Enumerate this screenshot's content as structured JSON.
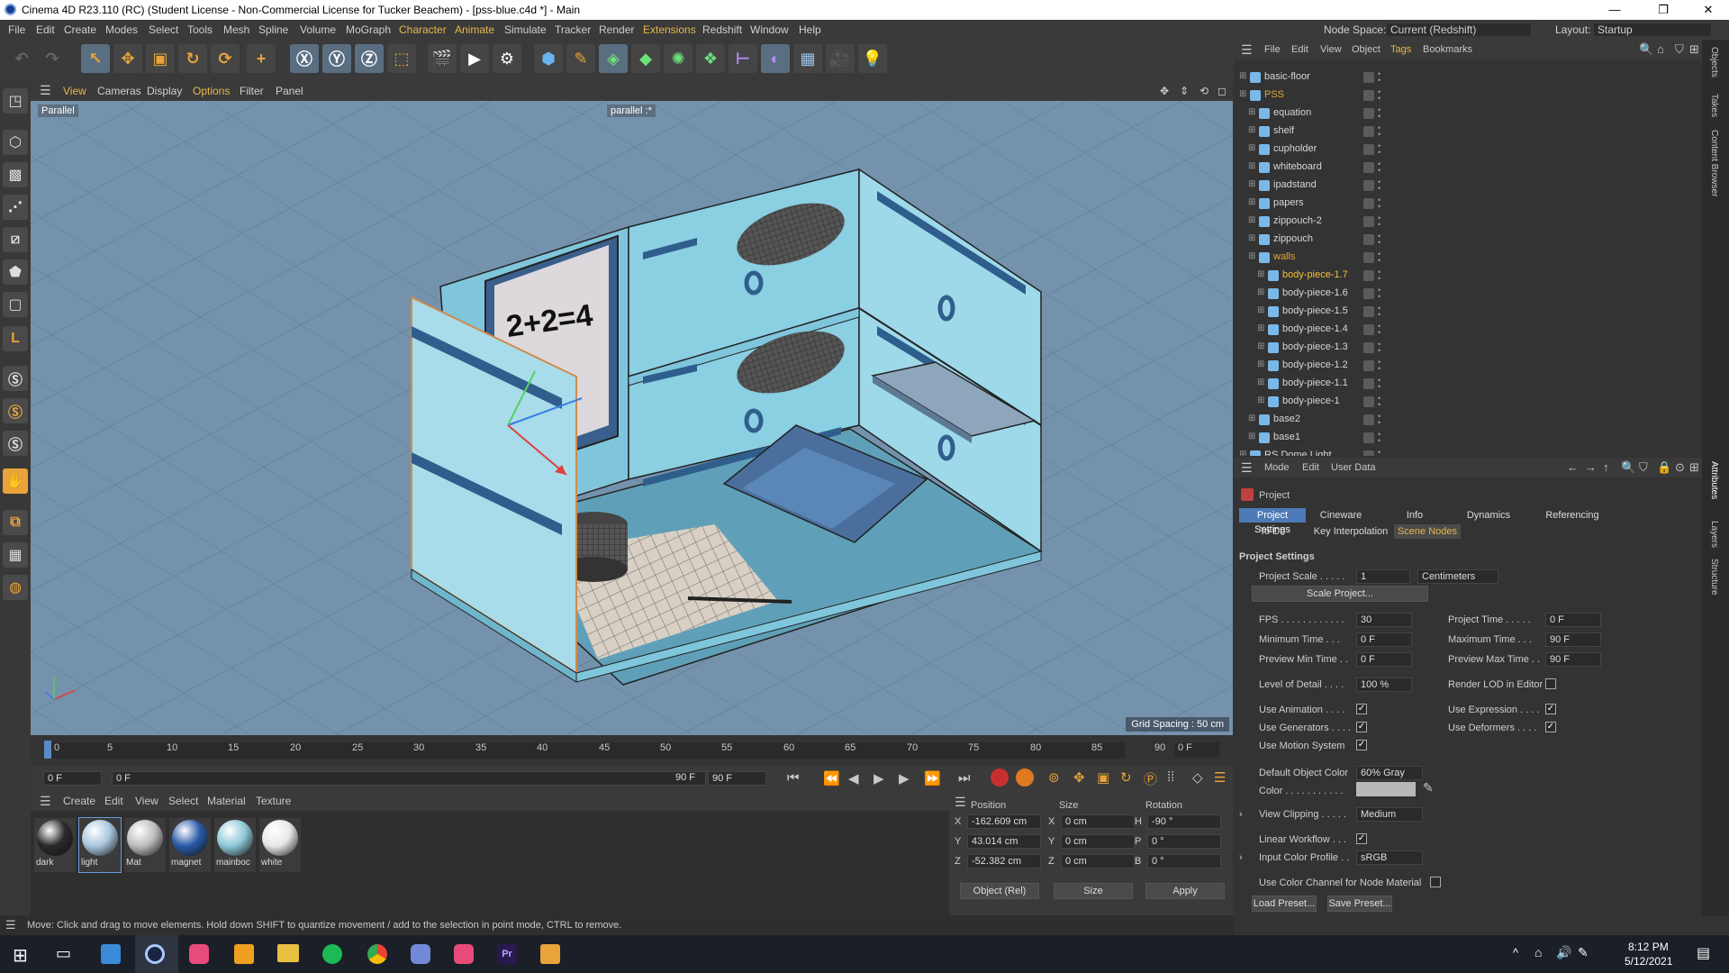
{
  "window": {
    "title": "Cinema 4D R23.110 (RC) (Student License - Non-Commercial License for Tucker Beachem) - [pss-blue.c4d *] - Main"
  },
  "menu": {
    "items": [
      "File",
      "Edit",
      "Create",
      "Modes",
      "Select",
      "Tools",
      "Mesh",
      "Spline",
      "Volume",
      "MoGraph",
      "Character",
      "Animate",
      "Simulate",
      "Tracker",
      "Render",
      "Extensions",
      "Redshift",
      "Window",
      "Help"
    ],
    "node_space_label": "Node Space:",
    "node_space_value": "Current (Redshift)",
    "layout_label": "Layout:",
    "layout_value": "Startup"
  },
  "viewport": {
    "menu": [
      "View",
      "Cameras",
      "Display",
      "Options",
      "Filter",
      "Panel"
    ],
    "camera_label": "Parallel",
    "view_label": "parallel :*",
    "grid_spacing": "Grid Spacing : 50 cm",
    "board_text": "2+2=4"
  },
  "timeline": {
    "ticks": [
      "0",
      "5",
      "10",
      "15",
      "20",
      "25",
      "30",
      "35",
      "40",
      "45",
      "50",
      "55",
      "60",
      "65",
      "70",
      "75",
      "80",
      "85",
      "90"
    ],
    "current_frame": "0 F",
    "start_field": "0 F",
    "min_field": "0 F",
    "max_field": "90 F",
    "end_field": "90 F"
  },
  "materials": {
    "menu": [
      "Create",
      "Edit",
      "View",
      "Select",
      "Material",
      "Texture"
    ],
    "items": [
      {
        "name": "dark",
        "color": "#2a2a2a"
      },
      {
        "name": "light",
        "color": "#a9c7de"
      },
      {
        "name": "Mat",
        "color": "#bdbdbd"
      },
      {
        "name": "magnet",
        "color": "#2a5aa8"
      },
      {
        "name": "mainboc",
        "color": "#8ec8d8"
      },
      {
        "name": "white",
        "color": "#e8e8e8"
      }
    ]
  },
  "coords": {
    "headers": [
      "Position",
      "Size",
      "Rotation"
    ],
    "rows": [
      {
        "axis": "X",
        "pos": "-162.609 cm",
        "saxis": "X",
        "size": "0 cm",
        "raxis": "H",
        "rot": "-90 °"
      },
      {
        "axis": "Y",
        "pos": "43.014 cm",
        "saxis": "Y",
        "size": "0 cm",
        "raxis": "P",
        "rot": "0 °"
      },
      {
        "axis": "Z",
        "pos": "-52.382 cm",
        "saxis": "Z",
        "size": "0 cm",
        "raxis": "B",
        "rot": "0 °"
      }
    ],
    "mode": "Object (Rel)",
    "size_mode": "Size",
    "apply": "Apply"
  },
  "status": "Move: Click and drag to move elements. Hold down SHIFT to quantize movement / add to the selection in point mode, CTRL to remove.",
  "objects": {
    "menu": [
      "File",
      "Edit",
      "View",
      "Object",
      "Tags",
      "Bookmarks"
    ],
    "rows": [
      {
        "name": "basic-floor",
        "indent": 0
      },
      {
        "name": "PSS",
        "indent": 0,
        "orange": true
      },
      {
        "name": "equation",
        "indent": 1
      },
      {
        "name": "shelf",
        "indent": 1
      },
      {
        "name": "cupholder",
        "indent": 1
      },
      {
        "name": "whiteboard",
        "indent": 1
      },
      {
        "name": "ipadstand",
        "indent": 1
      },
      {
        "name": "papers",
        "indent": 1
      },
      {
        "name": "zippouch-2",
        "indent": 1
      },
      {
        "name": "zippouch",
        "indent": 1
      },
      {
        "name": "walls",
        "indent": 1,
        "orange": true
      },
      {
        "name": "body-piece-1.7",
        "indent": 2,
        "yellow": true
      },
      {
        "name": "body-piece-1.6",
        "indent": 2
      },
      {
        "name": "body-piece-1.5",
        "indent": 2
      },
      {
        "name": "body-piece-1.4",
        "indent": 2
      },
      {
        "name": "body-piece-1.3",
        "indent": 2
      },
      {
        "name": "body-piece-1.2",
        "indent": 2
      },
      {
        "name": "body-piece-1.1",
        "indent": 2
      },
      {
        "name": "body-piece-1",
        "indent": 2
      },
      {
        "name": "base2",
        "indent": 1
      },
      {
        "name": "base1",
        "indent": 1
      },
      {
        "name": "RS Dome Light",
        "indent": 0
      }
    ]
  },
  "attributes": {
    "menu": [
      "Mode",
      "Edit",
      "User Data"
    ],
    "header": "Project",
    "tabs": [
      "Project Settings",
      "Cineware",
      "Info",
      "Dynamics",
      "Referencing"
    ],
    "tabs2": [
      "To Do",
      "Key Interpolation",
      "Scene Nodes"
    ],
    "section": "Project Settings",
    "project_scale_label": "Project Scale . . . . .",
    "project_scale": "1",
    "scale_unit": "Centimeters",
    "scale_project": "Scale Project...",
    "fps_label": "FPS . . . . . . . . . . . .",
    "fps": "30",
    "project_time_label": "Project Time . . . . .",
    "project_time": "0 F",
    "min_time_label": "Minimum Time . . .",
    "min_time": "0 F",
    "max_time_label": "Maximum Time . . .",
    "max_time": "90 F",
    "pmin_label": "Preview Min Time . .",
    "pmin": "0 F",
    "pmax_label": "Preview Max Time . .",
    "pmax": "90 F",
    "lod_label": "Level of Detail . . . .",
    "lod": "100 %",
    "render_lod_label": "Render LOD in Editor",
    "use_anim": "Use Animation . . . .",
    "use_expr": "Use Expression . . . .",
    "use_gen": "Use Generators . . . .",
    "use_def": "Use Deformers . . . .",
    "use_motion": "Use Motion System",
    "def_color_label": "Default Object Color",
    "def_color": "60% Gray",
    "color_label": "Color . . . . . . . . . . .",
    "view_clip_label": "View Clipping . . . . .",
    "view_clip": "Medium",
    "linear_label": "Linear Workflow . . .",
    "input_profile_label": "Input Color Profile . .",
    "input_profile": "sRGB",
    "use_color_channel": "Use Color Channel for Node Material",
    "load_preset": "Load Preset...",
    "save_preset": "Save Preset..."
  },
  "right_tabs": [
    "Objects",
    "Takes",
    "Content Browser",
    "Attributes",
    "Layers",
    "Structure"
  ],
  "taskbar": {
    "time": "8:12 PM",
    "date": "5/12/2021"
  }
}
